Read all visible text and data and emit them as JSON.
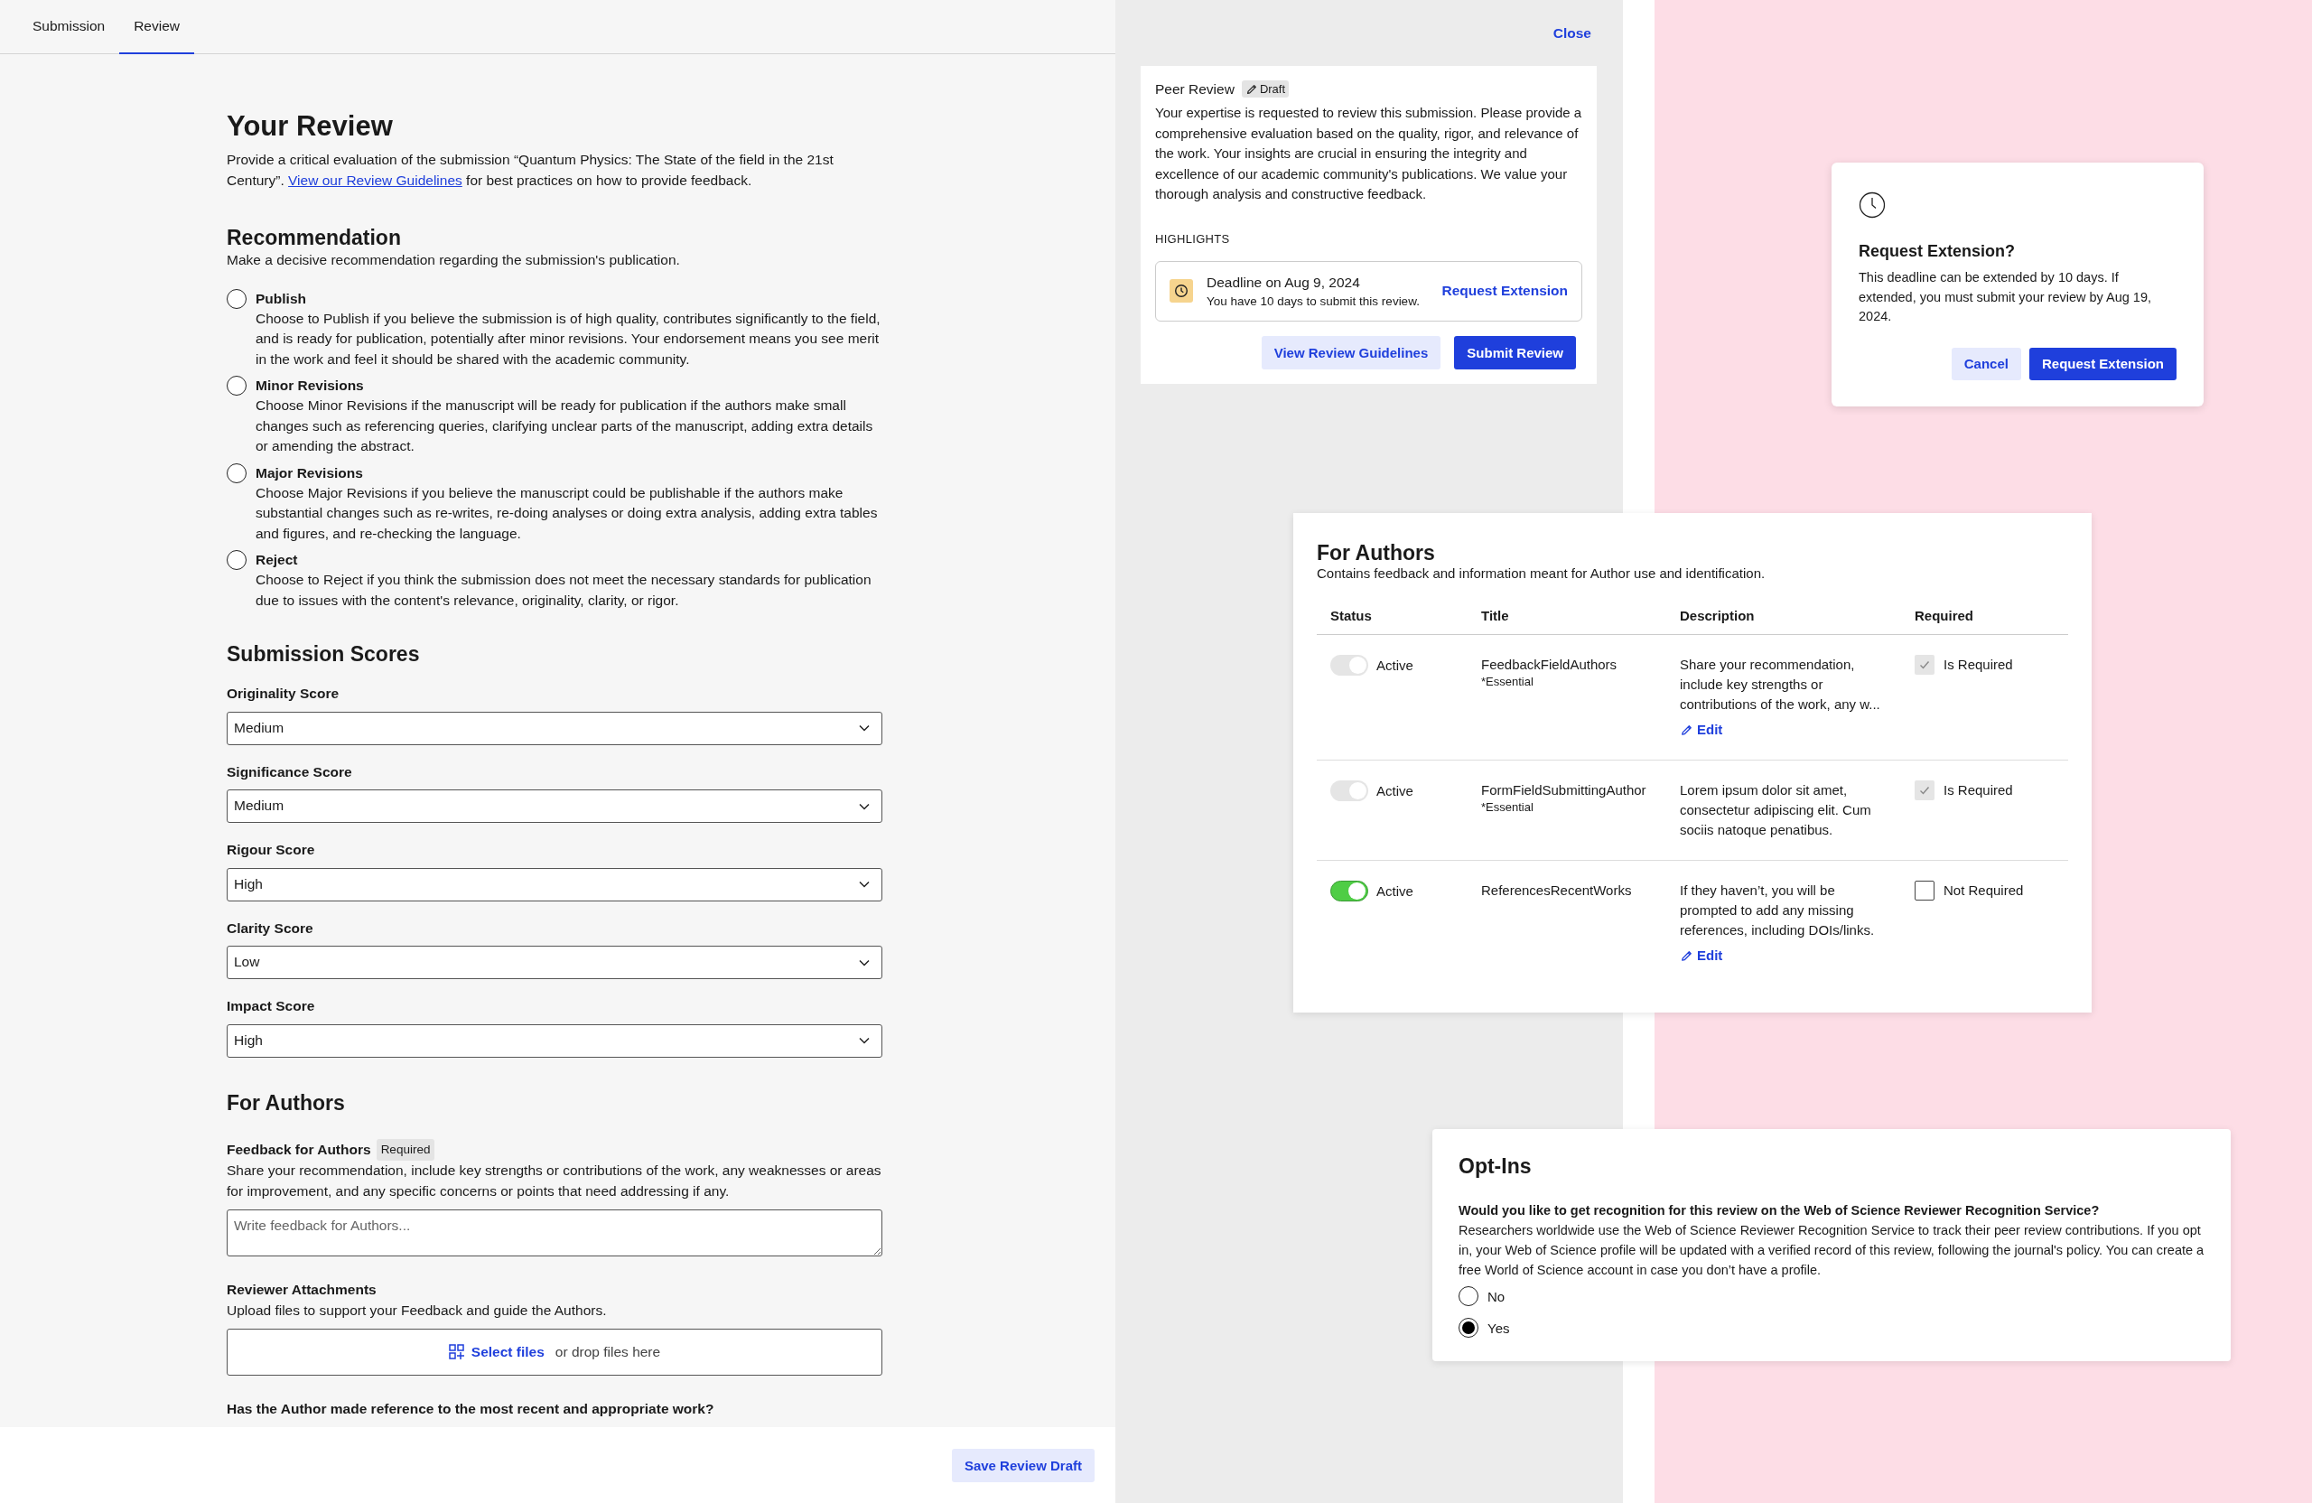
{
  "tabs": [
    {
      "label": "Submission",
      "selected": false
    },
    {
      "label": "Review",
      "selected": true
    }
  ],
  "review": {
    "title": "Your Review",
    "intro_before": "Provide a critical evaluation of the submission “Quantum Physics: The State of the field in the 21st Century”. ",
    "intro_link": "View our Review Guidelines",
    "intro_after": " for best practices on how to provide feedback.",
    "recommendation": {
      "title": "Recommendation",
      "description": "Make a decisive recommendation regarding the submission's publication.",
      "options": [
        {
          "label": "Publish",
          "description": "Choose to Publish if you believe the submission is of high quality, contributes significantly to the field, and is ready for publication, potentially after minor revisions. Your endorsement means you see merit in the work and feel it should be shared with the academic community.",
          "selected": false
        },
        {
          "label": "Minor Revisions",
          "description": "Choose Minor Revisions if the manuscript will be ready for publication if the authors make small changes such as referencing queries, clarifying unclear parts of the manuscript, adding extra details or amending the abstract.",
          "selected": false
        },
        {
          "label": "Major Revisions",
          "description": "Choose Major Revisions if you believe the manuscript could be publishable if the authors make substantial changes such as re-writes, re-doing analyses or doing extra analysis, adding extra tables and figures, and re-checking the language.",
          "selected": false
        },
        {
          "label": "Reject",
          "description": "Choose to Reject if you think the submission does not meet the necessary standards for publication due to issues with the content's relevance, originality, clarity, or rigor.",
          "selected": false
        }
      ]
    },
    "scores": {
      "title": "Submission Scores",
      "fields": [
        {
          "label": "Originality Score",
          "value": "Medium"
        },
        {
          "label": "Significance Score",
          "value": "Medium"
        },
        {
          "label": "Rigour Score",
          "value": "High"
        },
        {
          "label": "Clarity Score",
          "value": "Low"
        },
        {
          "label": "Impact Score",
          "value": "High"
        }
      ]
    },
    "for_authors": {
      "title": "For Authors",
      "feedback": {
        "label": "Feedback for Authors",
        "badge": "Required",
        "description": "Share your recommendation, include key strengths or contributions of the work, any weaknesses or areas for improvement, and any specific concerns or points that need addressing if any.",
        "placeholder": "Write feedback for Authors..."
      },
      "attachments": {
        "label": "Reviewer Attachments",
        "description": "Upload files to support your Feedback and guide the Authors.",
        "select_label": "Select files",
        "drop_text": "or drop files here"
      },
      "question": "Has the Author made reference to the most recent and appropriate work?"
    },
    "save_button": "Save Review Draft"
  },
  "side_panel": {
    "close": "Close",
    "card": {
      "title": "Peer Review",
      "badge": "Draft",
      "description": "Your expertise is requested to review this submission. Please provide a comprehensive evaluation based on the quality, rigor, and relevance of the work. Your insights are crucial in ensuring the integrity and excellence of our academic community's publications. We value your thorough analysis and constructive feedback.",
      "highlights_label": "HIGHLIGHTS",
      "deadline": {
        "title": "Deadline on Aug 9, 2024",
        "text": "You have 10 days to submit this review.",
        "action": "Request Extension"
      },
      "buttons": [
        {
          "label": "View Review Guidelines",
          "kind": "secondary"
        },
        {
          "label": "Submit Review",
          "kind": "primary"
        }
      ]
    }
  },
  "extension_dialog": {
    "title": "Request Extension?",
    "text": "This deadline can be extended by 10 days. If extended, you must submit your review by Aug 19, 2024.",
    "buttons": [
      {
        "label": "Cancel",
        "kind": "secondary"
      },
      {
        "label": "Request Extension",
        "kind": "primary"
      }
    ]
  },
  "authors_card": {
    "title": "For Authors",
    "description": "Contains feedback and information meant for Author use and identification.",
    "columns": [
      "Status",
      "Title",
      "Description",
      "Required"
    ],
    "rows": [
      {
        "on": true,
        "disabled": true,
        "status": "Active",
        "title": "FeedbackFieldAuthors",
        "note": "*Essential",
        "description": "Share your recommendation, include key strengths or contributions of the work, any w...",
        "edit": "Edit",
        "checked": true,
        "required_label": "Is Required"
      },
      {
        "on": true,
        "disabled": true,
        "status": "Active",
        "title": "FormFieldSubmittingAuthor",
        "note": "*Essential",
        "description": "Lorem ipsum dolor sit amet, consectetur adipiscing elit. Cum sociis natoque penatibus.",
        "checked": true,
        "required_label": "Is Required"
      },
      {
        "on": true,
        "disabled": false,
        "status": "Active",
        "title": "ReferencesRecentWorks",
        "description": "If they haven’t, you will be prompted to add any missing references, including DOIs/links.",
        "edit": "Edit",
        "checked": false,
        "required_label": "Not Required"
      }
    ]
  },
  "optins": {
    "title": "Opt-Ins",
    "question": "Would you like to get recognition for this review on the Web of Science Reviewer Recognition Service?",
    "description": "Researchers worldwide use the Web of Science Reviewer Recognition Service to track their peer review contributions. If you opt in, your Web of Science profile will be updated with a verified record of this review, following the journal's policy. You can create a free World of Science account in case you don’t have a profile.",
    "options": [
      {
        "label": "No",
        "selected": false
      },
      {
        "label": "Yes",
        "selected": true
      }
    ]
  }
}
